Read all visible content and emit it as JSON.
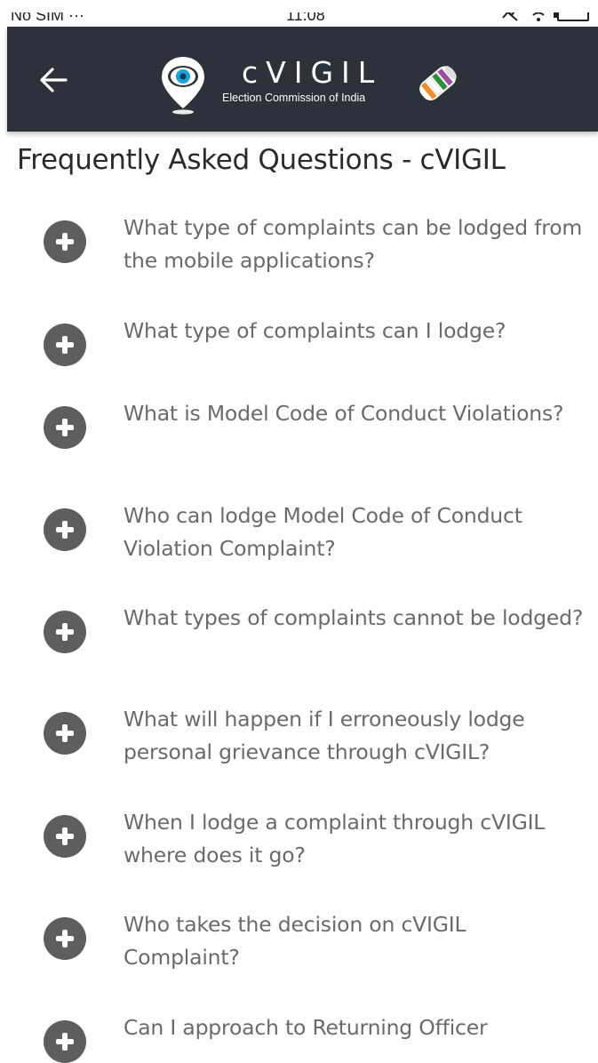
{
  "status_bar": {
    "carrier": "No SIM ···",
    "time": "11:08"
  },
  "app_bar": {
    "back_icon": "arrow-left-icon",
    "app_name": "cVIGIL",
    "subtitle": "Election Commission of India"
  },
  "page": {
    "title": "Frequently Asked Questions - cVIGIL"
  },
  "faq": {
    "expand_icon": "plus-circle-icon",
    "items": [
      {
        "question": "What type of complaints can be lodged from the mobile applications?"
      },
      {
        "question": "What type of complaints can I lodge?"
      },
      {
        "question": "What is Model Code of Conduct Violations?"
      },
      {
        "question": "Who can lodge Model Code of Conduct Violation Complaint?"
      },
      {
        "question": "What types of complaints cannot be lodged?"
      },
      {
        "question": "What will happen if I erroneously lodge personal grievance through cVIGIL?"
      },
      {
        "question": "When I lodge a complaint through cVIGIL where does it go?"
      },
      {
        "question": "Who takes the decision on cVIGIL Complaint?"
      },
      {
        "question": "Can I approach to Returning Officer"
      }
    ]
  },
  "colors": {
    "app_bar": "#2b3239",
    "icon_fill": "#5e5e5e",
    "question_text": "#6a6a6a",
    "title_text": "#2a2a2a"
  }
}
